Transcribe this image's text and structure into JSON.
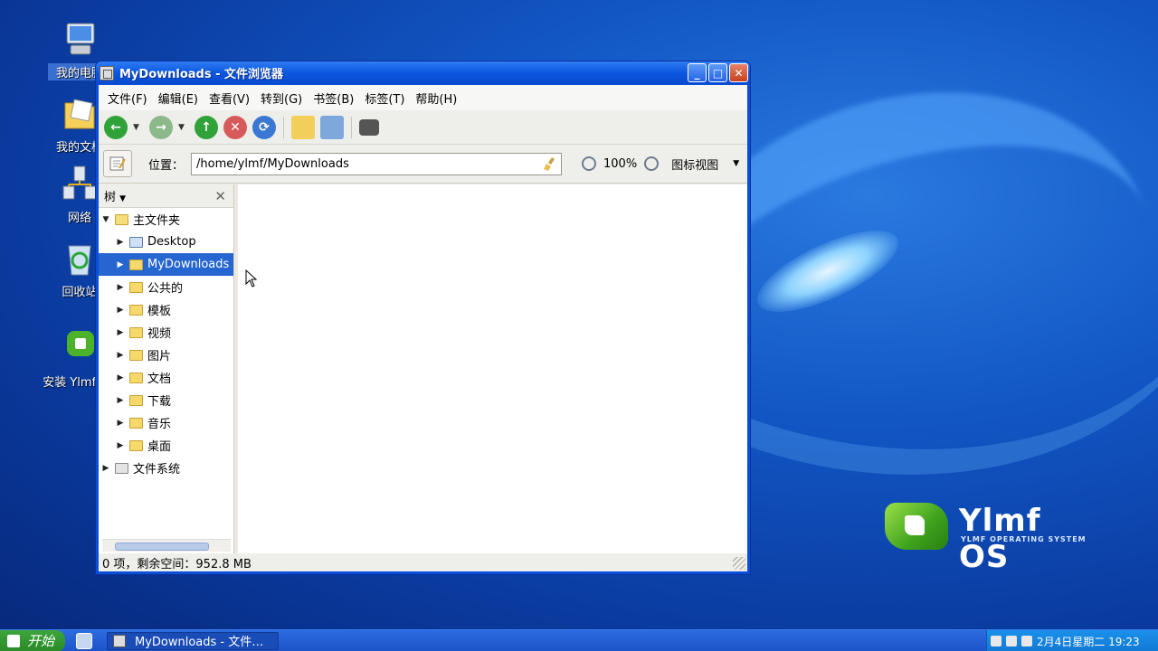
{
  "desktop": {
    "icons": [
      {
        "label": "我的电脑",
        "icon": "computer-icon"
      },
      {
        "label": "我的文档",
        "icon": "documents-folder-icon"
      },
      {
        "label": "网络",
        "icon": "network-icon"
      },
      {
        "label": "回收站",
        "icon": "recycle-bin-icon"
      },
      {
        "label": "安装 Ylmf OS",
        "icon": "install-icon"
      }
    ],
    "logo": {
      "title": "Ylmf OS",
      "subtitle": "YLMF OPERATING SYSTEM"
    }
  },
  "window": {
    "title": "MyDownloads - 文件浏览器",
    "menu": [
      "文件(F)",
      "编辑(E)",
      "查看(V)",
      "转到(G)",
      "书签(B)",
      "标签(T)",
      "帮助(H)"
    ],
    "location": {
      "label": "位置：",
      "path": "/home/ylmf/MyDownloads",
      "zoom": "100%",
      "view_mode": "图标视图"
    },
    "sidebar": {
      "title": "树",
      "root": "主文件夹",
      "items": [
        "Desktop",
        "MyDownloads",
        "公共的",
        "模板",
        "视频",
        "图片",
        "文档",
        "下载",
        "音乐",
        "桌面"
      ],
      "filesystem": "文件系统",
      "selected": "MyDownloads"
    },
    "status": "0 项，剩余空间：952.8 MB"
  },
  "taskbar": {
    "start_label": "开始",
    "task": "MyDownloads - 文件…",
    "clock": "2月4日星期二 19:23"
  },
  "colors": {
    "selection": "#2666d1",
    "title_bar": "#0b57df",
    "taskbar": "#1c55c8"
  }
}
